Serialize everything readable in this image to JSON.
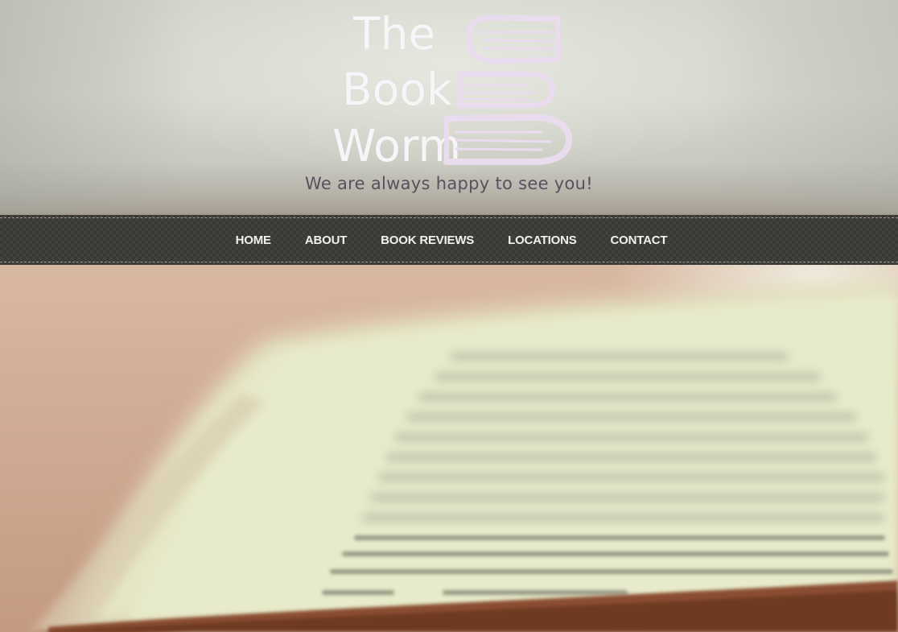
{
  "site": {
    "logo": {
      "line1": "The",
      "line2": "Book",
      "line3": "Worm",
      "icon": "stacked-books-icon"
    },
    "tagline": "We are always happy to see you!"
  },
  "nav": {
    "items": [
      {
        "label": "HOME"
      },
      {
        "label": "ABOUT"
      },
      {
        "label": "BOOK REVIEWS"
      },
      {
        "label": "LOCATIONS"
      },
      {
        "label": "CONTACT"
      }
    ]
  },
  "hero": {
    "image": "open-book-photo"
  },
  "colors": {
    "header_bg": "#d2d5cb",
    "logo_text": "#f7f5f8",
    "logo_books": "#e8dcec",
    "tagline": "#5a4f5e",
    "nav_bg": "#3a3834",
    "nav_text": "#f2f0ee",
    "page_paper": "#e6e8c8",
    "table_bg": "#cfa88f"
  }
}
